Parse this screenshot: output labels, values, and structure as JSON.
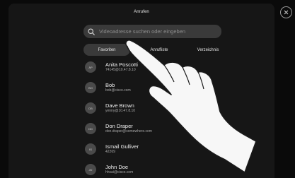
{
  "header": {
    "title": "Anrufen"
  },
  "search": {
    "placeholder": "Videoadresse suchen oder eingeben",
    "icon": "search-icon"
  },
  "tabs": [
    {
      "label": "Favoriten",
      "active": true
    },
    {
      "label": "Anrufliste",
      "active": false
    },
    {
      "label": "Verzeichnis",
      "active": false
    }
  ],
  "contacts": [
    {
      "name": "Anita Poscotti",
      "address": "74145@10.47.8.10",
      "initials": "AP"
    },
    {
      "name": "Bob",
      "address": "bob@cisco.com",
      "initials": "BO"
    },
    {
      "name": "Dave Brown",
      "address": "yenny@10.47.8.10",
      "initials": "DB"
    },
    {
      "name": "Don Draper",
      "address": "don.draper@somewhere.com",
      "initials": "DD"
    },
    {
      "name": "Ismail Gulliver",
      "address": "42269",
      "initials": "IG"
    },
    {
      "name": "John Doe",
      "address": "hhsai@cisco.com",
      "initials": "JD"
    }
  ],
  "colors": {
    "background": "#0a0a0a",
    "screen": "#161616",
    "control": "#3a3a3a",
    "avatar": "#4a4a4a"
  }
}
